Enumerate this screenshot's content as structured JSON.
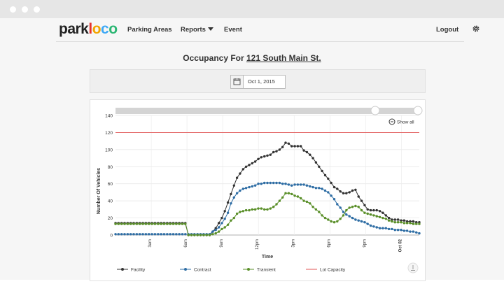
{
  "app": {
    "logo_parts": [
      "park",
      "l",
      "o",
      "c",
      "o"
    ]
  },
  "nav": {
    "parking_areas": "Parking Areas",
    "reports": "Reports",
    "event": "Event",
    "logout": "Logout",
    "settings_icon": "gear-icon"
  },
  "page": {
    "title_prefix": "Occupancy For",
    "location": "121 South Main St."
  },
  "datepicker": {
    "value": "Oct 1, 2015",
    "icon": "calendar-icon"
  },
  "chart_controls": {
    "show_all": "Show all",
    "zoom_icon": "zoom-out-icon",
    "download_icon": "download-icon"
  },
  "colors": {
    "facility": "#333333",
    "contract": "#2e6da4",
    "transient": "#5a8f29",
    "capacity": "#e25555",
    "logo": [
      "#222222",
      "#e5322d",
      "#f2a400",
      "#3fa9f5",
      "#2bb673"
    ]
  },
  "chart_data": {
    "type": "line",
    "xlabel": "Time",
    "ylabel": "Number Of Vehicles",
    "ylim": [
      0,
      140
    ],
    "yticks": [
      0,
      20,
      40,
      60,
      80,
      100,
      120,
      140
    ],
    "xtick_labels": [
      "3am",
      "6am",
      "9am",
      "12pm",
      "3pm",
      "6pm",
      "9pm",
      "Oct 02"
    ],
    "grid": true,
    "legend_position": "bottom",
    "capacity": {
      "name": "Lot Capacity",
      "value": 120
    },
    "series": [
      {
        "name": "Facility",
        "values": [
          14,
          14,
          14,
          14,
          14,
          14,
          14,
          14,
          14,
          14,
          14,
          14,
          14,
          14,
          14,
          14,
          14,
          14,
          14,
          14,
          14,
          14,
          14,
          14,
          0,
          0,
          0,
          0,
          0,
          0,
          0,
          0,
          4,
          8,
          14,
          20,
          28,
          38,
          48,
          58,
          67,
          72,
          77,
          80,
          82,
          84,
          86,
          89,
          91,
          92,
          93,
          94,
          97,
          98,
          100,
          103,
          108,
          107,
          104,
          104,
          104,
          104,
          99,
          97,
          94,
          90,
          85,
          80,
          75,
          70,
          66,
          61,
          56,
          54,
          51,
          49,
          49,
          50,
          52,
          53,
          45,
          40,
          35,
          30,
          29,
          29,
          29,
          28,
          26,
          23,
          20,
          18,
          18,
          18,
          17,
          17,
          16,
          16,
          16,
          15,
          15
        ]
      },
      {
        "name": "Contract",
        "values": [
          1,
          1,
          1,
          1,
          1,
          1,
          1,
          1,
          1,
          1,
          1,
          1,
          1,
          1,
          1,
          1,
          1,
          1,
          1,
          1,
          1,
          1,
          1,
          1,
          1,
          1,
          1,
          1,
          1,
          1,
          1,
          1,
          4,
          6,
          9,
          14,
          19,
          26,
          37,
          44,
          49,
          52,
          54,
          55,
          56,
          57,
          58,
          60,
          60,
          61,
          61,
          61,
          61,
          61,
          61,
          60,
          60,
          59,
          58,
          59,
          59,
          59,
          59,
          58,
          57,
          56,
          55,
          55,
          54,
          52,
          50,
          46,
          42,
          36,
          32,
          27,
          24,
          22,
          20,
          18,
          17,
          16,
          15,
          13,
          11,
          10,
          9,
          8,
          8,
          8,
          7,
          7,
          6,
          6,
          6,
          5,
          5,
          4,
          4,
          3,
          2
        ]
      },
      {
        "name": "Transient",
        "values": [
          13,
          13,
          13,
          13,
          13,
          13,
          13,
          13,
          13,
          13,
          13,
          13,
          13,
          13,
          13,
          13,
          13,
          13,
          13,
          13,
          13,
          13,
          13,
          13,
          0,
          0,
          0,
          0,
          0,
          0,
          0,
          0,
          1,
          2,
          4,
          7,
          9,
          12,
          17,
          20,
          25,
          27,
          28,
          29,
          29,
          30,
          30,
          31,
          31,
          30,
          30,
          31,
          33,
          36,
          40,
          44,
          49,
          49,
          48,
          46,
          45,
          43,
          40,
          39,
          37,
          33,
          30,
          27,
          23,
          20,
          18,
          16,
          15,
          16,
          19,
          23,
          29,
          32,
          33,
          34,
          33,
          29,
          26,
          25,
          24,
          23,
          22,
          21,
          20,
          19,
          17,
          16,
          15,
          15,
          15,
          14,
          14,
          14,
          13,
          13,
          13
        ]
      }
    ]
  }
}
